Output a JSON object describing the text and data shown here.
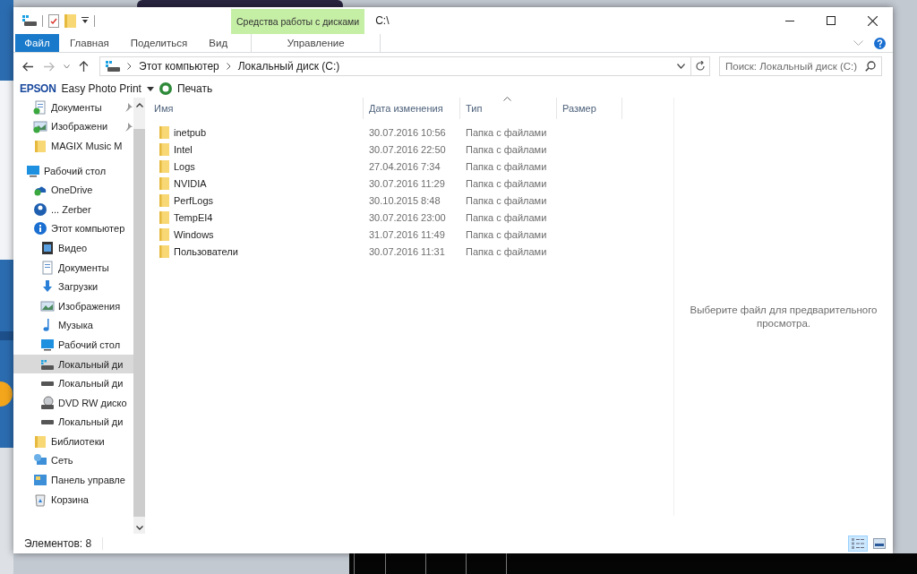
{
  "window": {
    "title": "C:\\"
  },
  "context_tab_group": {
    "label": "Средства работы с дисками"
  },
  "ribbon_tabs": [
    {
      "label": "Файл",
      "kind": "file"
    },
    {
      "label": "Главная",
      "kind": "tab"
    },
    {
      "label": "Поделиться",
      "kind": "tab"
    },
    {
      "label": "Вид",
      "kind": "tab"
    },
    {
      "label": "Управление",
      "kind": "context"
    }
  ],
  "address": {
    "crumbs": [
      "Этот компьютер",
      "Локальный диск (C:)"
    ]
  },
  "search": {
    "placeholder": "Поиск: Локальный диск (C:)"
  },
  "epson_toolbar": {
    "logo": "EPSON",
    "app": "Easy Photo Print",
    "print": "Печать"
  },
  "nav": {
    "quick_access": [
      {
        "label": "Документы",
        "kind": "docs",
        "pinned": true,
        "selected": false
      },
      {
        "label": "Изображени",
        "kind": "images",
        "pinned": true,
        "selected": false
      },
      {
        "label": "MAGIX Music M",
        "kind": "folder",
        "pinned": false,
        "selected": false
      }
    ],
    "tree": [
      {
        "label": "Рабочий стол",
        "kind": "desktop",
        "selected": false,
        "children": [
          {
            "label": "OneDrive",
            "kind": "cloud",
            "selected": false
          },
          {
            "label": "... Zerber",
            "kind": "user",
            "selected": false
          },
          {
            "label": "Этот компьютер",
            "kind": "info",
            "selected": false,
            "children": [
              {
                "label": "Видео",
                "kind": "video",
                "selected": false
              },
              {
                "label": "Документы",
                "kind": "doc",
                "selected": false
              },
              {
                "label": "Загрузки",
                "kind": "download",
                "selected": false
              },
              {
                "label": "Изображения",
                "selected": false
              },
              {
                "label": "Музыка",
                "kind": "music",
                "selected": false
              },
              {
                "label": "Рабочий стол",
                "kind": "desktop",
                "selected": false
              },
              {
                "label": "Локальный ди",
                "kind": "windrive",
                "selected": true
              },
              {
                "label": "Локальный ди",
                "kind": "drive",
                "selected": false
              },
              {
                "label": "DVD RW диско",
                "kind": "dvd",
                "selected": false
              },
              {
                "label": "Локальный ди",
                "kind": "drive",
                "selected": false
              }
            ]
          },
          {
            "label": "Библиотеки",
            "kind": "libraries",
            "selected": false
          },
          {
            "label": "Сеть",
            "kind": "network",
            "selected": false
          },
          {
            "label": "Панель управле",
            "kind": "panel",
            "selected": false
          },
          {
            "label": "Корзина",
            "kind": "trash",
            "selected": false
          }
        ]
      }
    ]
  },
  "columns": [
    {
      "label": "Имя",
      "sorted": false
    },
    {
      "label": "Дата изменения",
      "sorted": false
    },
    {
      "label": "Тип",
      "sorted": true
    },
    {
      "label": "Размер",
      "sorted": false
    }
  ],
  "files": [
    {
      "name": "inetpub",
      "modified": "30.07.2016 10:56",
      "type": "Папка с файлами"
    },
    {
      "name": "Intel",
      "modified": "30.07.2016 22:50",
      "type": "Папка с файлами"
    },
    {
      "name": "Logs",
      "modified": "27.04.2016 7:34",
      "type": "Папка с файлами"
    },
    {
      "name": "NVIDIA",
      "modified": "30.07.2016 11:29",
      "type": "Папка с файлами"
    },
    {
      "name": "PerfLogs",
      "modified": "30.10.2015 8:48",
      "type": "Папка с файлами"
    },
    {
      "name": "TempEI4",
      "modified": "30.07.2016 23:00",
      "type": "Папка с файлами"
    },
    {
      "name": "Windows",
      "modified": "31.07.2016 11:49",
      "type": "Папка с файлами"
    },
    {
      "name": "Пользователи",
      "modified": "30.07.2016 11:31",
      "type": "Папка с файлами"
    }
  ],
  "preview": {
    "message": "Выберите файл для предварительного просмотра."
  },
  "status_bar": {
    "count": "Элементов: 8",
    "views": [
      {
        "kind": "details",
        "selected": true
      },
      {
        "kind": "large-icons",
        "selected": false
      }
    ]
  }
}
